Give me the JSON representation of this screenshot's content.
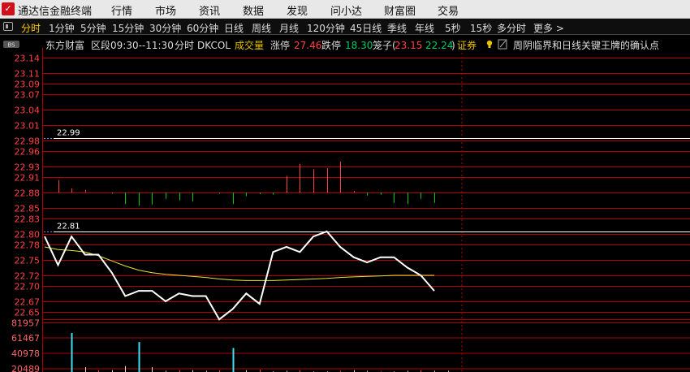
{
  "app": {
    "logo": "✓",
    "title": "通达信金融终端"
  },
  "menu": [
    "行情",
    "市场",
    "资讯",
    "数据",
    "发现",
    "问小达",
    "财富圈",
    "交易"
  ],
  "timeframes": [
    "分时",
    "1分钟",
    "5分钟",
    "15分钟",
    "30分钟",
    "60分钟",
    "日线",
    "周线",
    "月线",
    "120分钟",
    "45日线",
    "季线",
    "年线",
    "5秒",
    "15秒",
    "多分时",
    "更多 >"
  ],
  "active_timeframe": "分时",
  "info": {
    "badge": "BS",
    "stock": "东方财富",
    "segment": "区段09:30--11:30",
    "mode": "分时",
    "indicator_name": "DKCOL",
    "indicator_series": "成交量",
    "limit_up_label": "涨停",
    "limit_up": "27.46",
    "limit_down_label": "跌停",
    "limit_down": "18.30",
    "cage_label": "笼子(",
    "cage_high": "23.15",
    "cage_low": "22.24",
    "cage_close": ")",
    "sector": "证券",
    "note": "周阴临界和日线关键王牌的确认点"
  },
  "colors": {
    "up": "#ff4040",
    "down": "#00cc00",
    "price": "#ffffff",
    "avg": "#e6e632",
    "grid": "#b30000",
    "volume_axis": "#ff6666",
    "yellow": "#ffcc00"
  },
  "chart_data": {
    "type": "line",
    "y_ticks": [
      "23.14",
      "23.11",
      "23.09",
      "23.07",
      "23.04",
      "23.01",
      "22.98",
      "22.96",
      "22.93",
      "22.91",
      "22.88",
      "22.85",
      "22.83",
      "22.80",
      "22.78",
      "22.75",
      "22.72",
      "22.70",
      "22.67",
      "22.65"
    ],
    "ylim": [
      22.64,
      23.15
    ],
    "reference_lines": [
      {
        "label": "22.99",
        "value": 22.985
      },
      {
        "label": "22.81",
        "value": 22.805
      }
    ],
    "baseline": 22.88,
    "price": [
      22.795,
      22.74,
      22.795,
      22.76,
      22.76,
      22.725,
      22.68,
      22.69,
      22.69,
      22.67,
      22.685,
      22.68,
      22.68,
      22.635,
      22.655,
      22.685,
      22.665,
      22.765,
      22.775,
      22.765,
      22.795,
      22.805,
      22.775,
      22.755,
      22.745,
      22.755,
      22.755,
      22.735,
      22.72,
      22.69
    ],
    "avg_price": [
      22.775,
      22.77,
      22.768,
      22.765,
      22.758,
      22.748,
      22.738,
      22.73,
      22.725,
      22.722,
      22.72,
      22.718,
      22.716,
      22.713,
      22.711,
      22.71,
      22.71,
      22.71,
      22.711,
      22.712,
      22.713,
      22.714,
      22.716,
      22.717,
      22.718,
      22.719,
      22.72,
      22.72,
      22.72,
      22.72
    ],
    "bars": [
      0,
      0.024,
      0.008,
      0.005,
      0,
      -0.002,
      -0.022,
      -0.025,
      -0.023,
      -0.012,
      -0.015,
      -0.017,
      0,
      -0.002,
      -0.022,
      -0.007,
      -0.003,
      -0.004,
      0.032,
      0.055,
      0.045,
      0.047,
      0.06,
      0.003,
      -0.006,
      -0.004,
      -0.02,
      -0.022,
      -0.012,
      -0.02
    ],
    "volume_ticks": [
      "81957",
      "61467",
      "40978",
      "20489"
    ],
    "volume_max": 81957,
    "volume": [
      0,
      65000,
      8000,
      3000,
      3000,
      10000,
      50000,
      8000,
      2000,
      3000,
      3000,
      2000,
      3000,
      40000,
      3000,
      4000,
      1000,
      2000,
      3000,
      1000,
      1000,
      2000,
      3000,
      2000,
      1000,
      1000,
      2000,
      3000,
      2000,
      2000
    ]
  }
}
